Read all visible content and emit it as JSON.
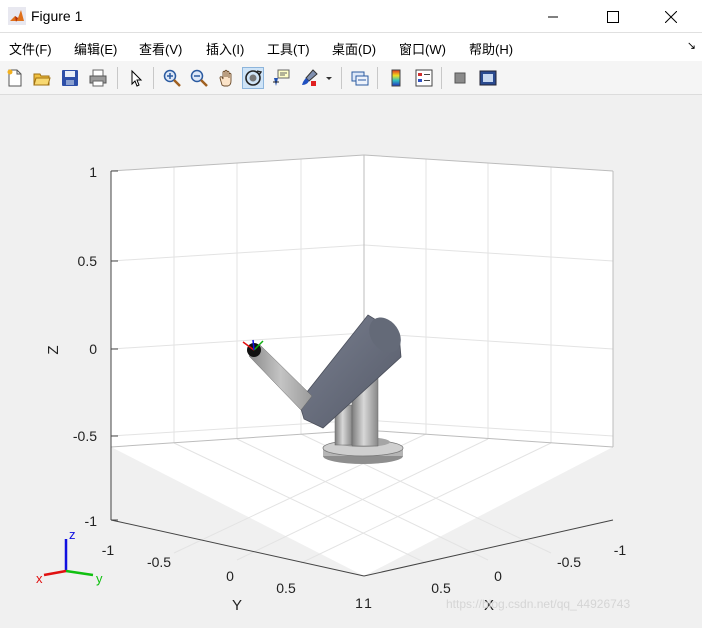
{
  "window": {
    "title": "Figure 1",
    "minimize_icon": "minimize-icon",
    "maximize_icon": "maximize-icon",
    "close_icon": "close-icon"
  },
  "menu": {
    "items": [
      "文件(F)",
      "编辑(E)",
      "查看(V)",
      "插入(I)",
      "工具(T)",
      "桌面(D)",
      "窗口(W)",
      "帮助(H)"
    ],
    "more_icon": "↘"
  },
  "toolbar": {
    "buttons": [
      "new-figure-icon",
      "open-file-icon",
      "save-icon",
      "print-icon",
      "edit-plot-icon",
      "zoom-in-icon",
      "zoom-out-icon",
      "pan-icon",
      "rotate-3d-icon",
      "data-cursor-icon",
      "brush-icon",
      "link-plot-icon",
      "colorbar-icon",
      "legend-icon",
      "hide-plot-tools-icon",
      "show-plot-tools-icon"
    ],
    "active": "rotate-3d-icon"
  },
  "plot": {
    "z_ticks": [
      "1",
      "0.5",
      "0",
      "-0.5",
      "-1"
    ],
    "y_ticks": [
      "-1",
      "-0.5",
      "0",
      "0.5",
      "1"
    ],
    "x_ticks": [
      "1",
      "0.5",
      "0",
      "-0.5",
      "-1"
    ],
    "x_label": "X",
    "y_label": "Y",
    "z_label": "Z",
    "triad": {
      "x": "x",
      "y": "y",
      "z": "z"
    }
  },
  "watermark": "https://blog.csdn.net/qq_44926743",
  "colors": {
    "robot_arm": "#6b7180",
    "robot_base": "#a9a9a9",
    "axis_x": "#e01010",
    "axis_y": "#10c010",
    "axis_z": "#1010e0"
  }
}
